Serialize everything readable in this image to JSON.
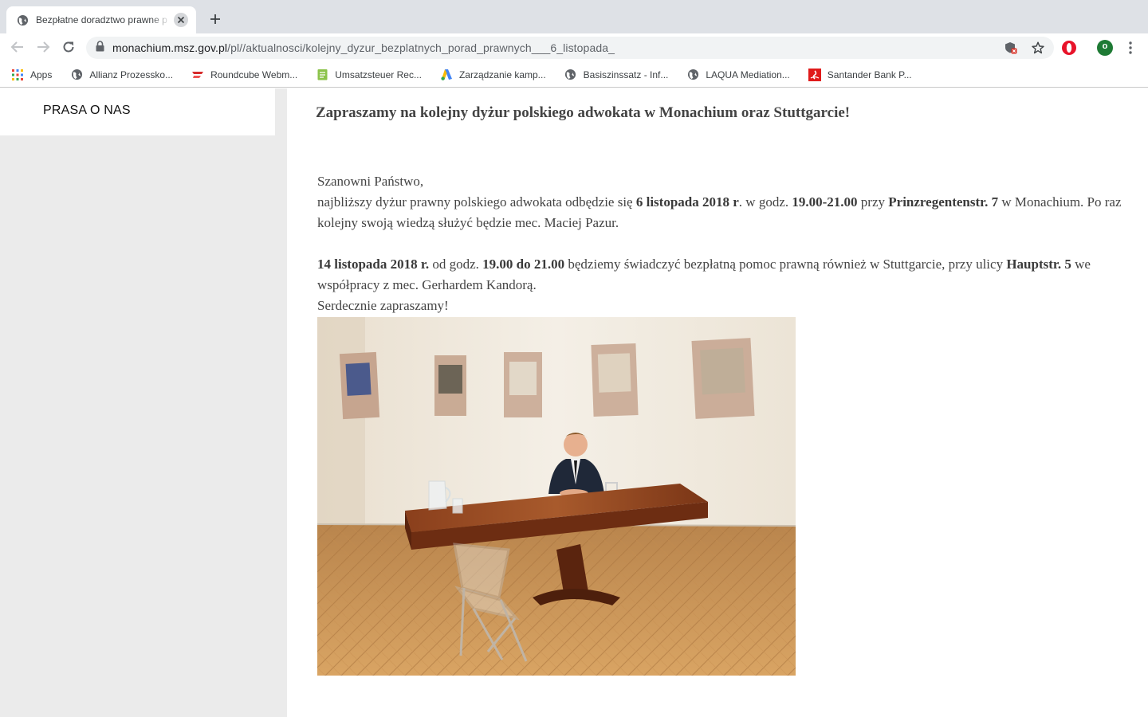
{
  "browser": {
    "tab_title": "Bezpłatne doradztwo prawne p",
    "url_host": "monachium.msz.gov.pl",
    "url_path": "/pl//aktualnosci/kolejny_dyzur_bezplatnych_porad_prawnych___6_listopada_",
    "profile_initial": "o",
    "bookmarks": [
      {
        "label": "Apps",
        "icon": "apps-grid-icon"
      },
      {
        "label": "Allianz Prozessko...",
        "icon": "globe-icon"
      },
      {
        "label": "Roundcube Webm...",
        "icon": "roundcube-icon"
      },
      {
        "label": "Umsatzsteuer Rec...",
        "icon": "notepad-icon"
      },
      {
        "label": "Zarządzanie kamp...",
        "icon": "google-ads-icon"
      },
      {
        "label": "Basiszinssatz - Inf...",
        "icon": "globe-icon"
      },
      {
        "label": "LAQUA Mediation...",
        "icon": "globe-icon"
      },
      {
        "label": "Santander Bank P...",
        "icon": "santander-icon"
      }
    ]
  },
  "sidebar": {
    "link_label": "PRASA O NAS"
  },
  "article": {
    "headline": "Zapraszamy na kolejny dyżur polskiego adwokata w Monachium oraz Stuttgarcie!",
    "greeting": "Szanowni Państwo,",
    "p1_a": "najbliższy dyżur prawny polskiego adwokata odbędzie się ",
    "p1_date": "6 listopada 2018 r",
    "p1_b": ". w godz. ",
    "p1_time": "19.00-21.00",
    "p1_c": " przy ",
    "p1_addr": "Prinzregentenstr. 7",
    "p1_d": " w Monachium. Po raz kolejny swoją wiedzą służyć będzie mec. Maciej Pazur.",
    "p2_date": "14 listopada 2018 r.",
    "p2_a": " od godz. ",
    "p2_time": "19.00 do 21.00",
    "p2_b": " będziemy świadczyć bezpłatną pomoc prawną również w Stuttgarcie, przy ulicy ",
    "p2_addr": "Hauptstr. 5",
    "p2_c": " we współpracy z mec. Gerhardem Kandorą.",
    "closing": "Serdecznie zapraszamy!"
  },
  "colors": {
    "tabbar_bg": "#dee1e6",
    "sidebar_bg": "#ebebeb",
    "opera_red": "#e8132a",
    "profile_green": "#1e7a34"
  }
}
